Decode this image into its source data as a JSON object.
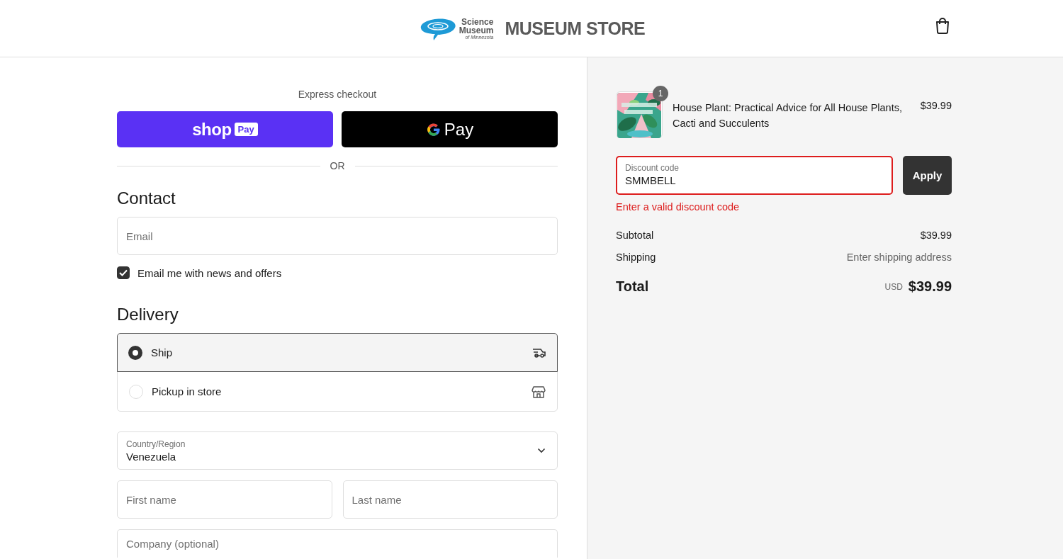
{
  "header": {
    "logo_lines": [
      "Science",
      "Museum",
      "of Minnesota"
    ],
    "store_name": "MUSEUM STORE"
  },
  "express": {
    "title": "Express checkout",
    "buttons": [
      {
        "kind": "shop",
        "label": "shop",
        "badge": "Pay"
      },
      {
        "kind": "gpay",
        "label": "Pay"
      }
    ],
    "divider": "OR"
  },
  "contact": {
    "heading": "Contact",
    "email": {
      "placeholder": "Email"
    },
    "newsletter": {
      "label": "Email me with news and offers",
      "checked": true
    }
  },
  "delivery": {
    "heading": "Delivery",
    "options": [
      {
        "label": "Ship",
        "selected": true,
        "kind": "truck"
      },
      {
        "label": "Pickup in store",
        "selected": false,
        "kind": "store"
      }
    ],
    "country": {
      "label": "Country/Region",
      "value": "Venezuela"
    },
    "first_name": {
      "placeholder": "First name"
    },
    "last_name": {
      "placeholder": "Last name"
    },
    "company": {
      "placeholder": "Company (optional)"
    }
  },
  "summary": {
    "items": [
      {
        "title": "House Plant: Practical Advice for All House Plants, Cacti and Succulents",
        "price": "$39.99",
        "quantity": "1"
      }
    ],
    "discount": {
      "label": "Discount code",
      "value": "SMMBELL",
      "error": "Enter a valid discount code",
      "button": "Apply"
    },
    "lines": [
      {
        "label": "Subtotal",
        "value": "$39.99",
        "kind": "amount"
      },
      {
        "label": "Shipping",
        "value": "Enter shipping address",
        "kind": "note"
      }
    ],
    "total": {
      "label": "Total",
      "currency": "USD",
      "value": "$39.99"
    }
  }
}
